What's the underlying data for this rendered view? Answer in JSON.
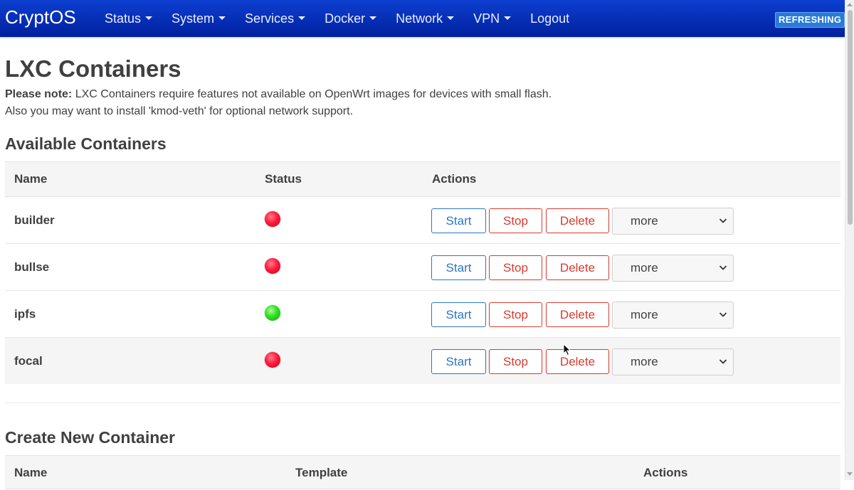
{
  "nav": {
    "brand": "CryptOS",
    "items": [
      {
        "label": "Status",
        "dropdown": true
      },
      {
        "label": "System",
        "dropdown": true
      },
      {
        "label": "Services",
        "dropdown": true
      },
      {
        "label": "Docker",
        "dropdown": true
      },
      {
        "label": "Network",
        "dropdown": true
      },
      {
        "label": "VPN",
        "dropdown": true
      },
      {
        "label": "Logout",
        "dropdown": false
      }
    ],
    "badge": "REFRESHING"
  },
  "page": {
    "title": "LXC Containers",
    "note_label": "Please note:",
    "note_line1": " LXC Containers require features not available on OpenWrt images for devices with small flash.",
    "note_line2": "Also you may want to install 'kmod-veth' for optional network support."
  },
  "available": {
    "title": "Available Containers",
    "headers": {
      "name": "Name",
      "status": "Status",
      "actions": "Actions"
    },
    "rows": [
      {
        "name": "builder",
        "running": false
      },
      {
        "name": "bullse",
        "running": false
      },
      {
        "name": "ipfs",
        "running": true
      },
      {
        "name": "focal",
        "running": false
      }
    ],
    "buttons": {
      "start": "Start",
      "stop": "Stop",
      "delete": "Delete",
      "more": "more"
    }
  },
  "create": {
    "title": "Create New Container",
    "headers": {
      "name": "Name",
      "template": "Template",
      "actions": "Actions"
    }
  },
  "colors": {
    "navbar": "#0d3fd0",
    "primary_button": "#2a76c6",
    "danger_button": "#d63b2f",
    "status_stopped": "#ff1a3a",
    "status_running": "#2fe01e"
  }
}
